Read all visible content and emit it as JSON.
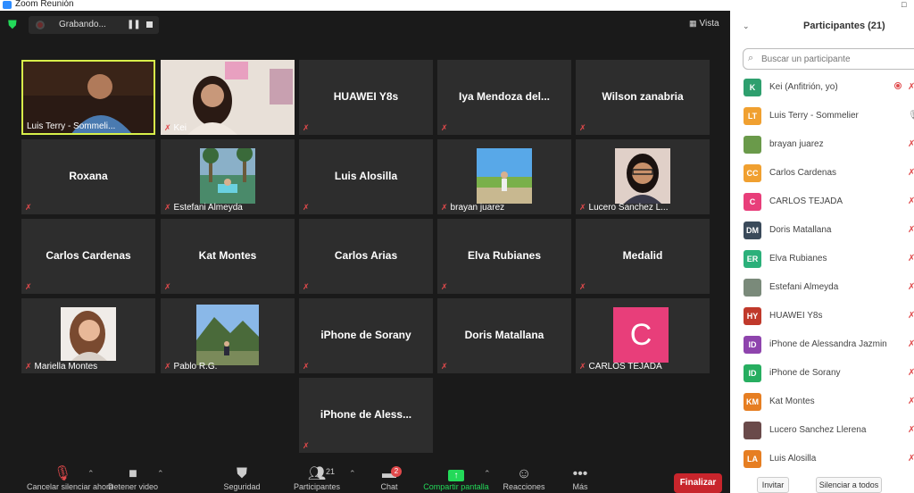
{
  "window": {
    "title": "Zoom Reunión",
    "controls": "□"
  },
  "meeting": {
    "recording_label": "Grabando...",
    "pause_icon": "pause-icon",
    "view_label": "Vista",
    "tiles": [
      {
        "name": "",
        "label": "Luis Terry - Sommeli..."
      },
      {
        "name": "",
        "label": "Kei"
      },
      {
        "name": "HUAWEI Y8s",
        "label": ""
      },
      {
        "name": "Iya  Mendoza  del...",
        "label": ""
      },
      {
        "name": "Wilson zanabria",
        "label": ""
      },
      {
        "name": "Roxana",
        "label": ""
      },
      {
        "name": "",
        "label": "Estefani Almeyda"
      },
      {
        "name": "Luis Alosilla",
        "label": ""
      },
      {
        "name": "",
        "label": "brayan juarez"
      },
      {
        "name": "",
        "label": "Lucero Sanchez L..."
      },
      {
        "name": "Carlos Cardenas",
        "label": ""
      },
      {
        "name": "Kat Montes",
        "label": ""
      },
      {
        "name": "Carlos Arias",
        "label": ""
      },
      {
        "name": "Elva Rubianes",
        "label": ""
      },
      {
        "name": "Medalid",
        "label": ""
      },
      {
        "name": "",
        "label": "Mariella Montes"
      },
      {
        "name": "",
        "label": "Pablo R.G."
      },
      {
        "name": "iPhone de Sorany",
        "label": ""
      },
      {
        "name": "Doris Matallana",
        "label": ""
      },
      {
        "name": "",
        "label": "CARLOS TEJADA",
        "avatar_letter": "C"
      },
      {
        "name": "iPhone  de  Aless...",
        "label": ""
      }
    ]
  },
  "toolbar": {
    "audio_label": "Cancelar silenciar ahora",
    "video_label": "Detener video",
    "security_label": "Seguridad",
    "participants_label": "Participantes",
    "participants_count": "21",
    "chat_label": "Chat",
    "chat_badge": "2",
    "share_label": "Compartir pantalla",
    "reactions_label": "Reacciones",
    "more_label": "Más",
    "end_label": "Finalizar"
  },
  "panel": {
    "title": "Participantes (21)",
    "search_placeholder": "Buscar un participante",
    "participants": [
      {
        "initials": "K",
        "name": "Kei (Anfitrión, yo)",
        "color": "#2e9f6e"
      },
      {
        "initials": "LT",
        "name": "Luis Terry - Sommelier",
        "color": "#f0a030"
      },
      {
        "initials": "",
        "name": "brayan juarez",
        "color": "#6a9a4a"
      },
      {
        "initials": "CC",
        "name": "Carlos Cardenas",
        "color": "#f0a030"
      },
      {
        "initials": "C",
        "name": "CARLOS TEJADA",
        "color": "#e83e7a"
      },
      {
        "initials": "DM",
        "name": "Doris Matallana",
        "color": "#3a4a5a"
      },
      {
        "initials": "ER",
        "name": "Elva Rubianes",
        "color": "#2bb07a"
      },
      {
        "initials": "",
        "name": "Estefani Almeyda",
        "color": "#7a8a7a"
      },
      {
        "initials": "HY",
        "name": "HUAWEI Y8s",
        "color": "#c0392b"
      },
      {
        "initials": "ID",
        "name": "iPhone de Alessandra Jazmin",
        "color": "#8e44ad"
      },
      {
        "initials": "ID",
        "name": "iPhone de Sorany",
        "color": "#27ae60"
      },
      {
        "initials": "KM",
        "name": "Kat Montes",
        "color": "#e67e22"
      },
      {
        "initials": "",
        "name": "Lucero Sanchez Llerena",
        "color": "#6a4a4a"
      },
      {
        "initials": "LA",
        "name": "Luis Alosilla",
        "color": "#e67e22"
      }
    ],
    "invite_label": "Invitar",
    "mute_all_label": "Silenciar a todos"
  }
}
